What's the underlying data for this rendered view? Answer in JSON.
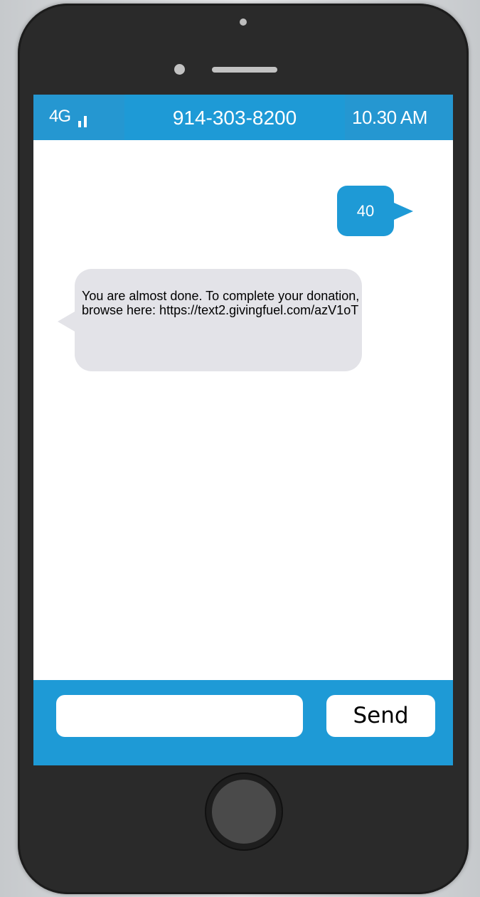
{
  "status_bar": {
    "network": "4G",
    "signal_icon": "signal-bars-icon",
    "contact_number": "914-303-8200",
    "time": "10.30 AM",
    "color": "#1e9ad6"
  },
  "conversation": {
    "outgoing": [
      {
        "text": "40"
      }
    ],
    "incoming": [
      {
        "text": "You are almost done. To complete your donation, browse here: https://text2.givingfuel.com/azV1oT"
      }
    ]
  },
  "compose": {
    "input_value": "",
    "send_label": "Send"
  },
  "colors": {
    "accent": "#1e9ad6",
    "incoming_bubble": "#e3e3e8",
    "phone_body": "#2a2a2a"
  }
}
